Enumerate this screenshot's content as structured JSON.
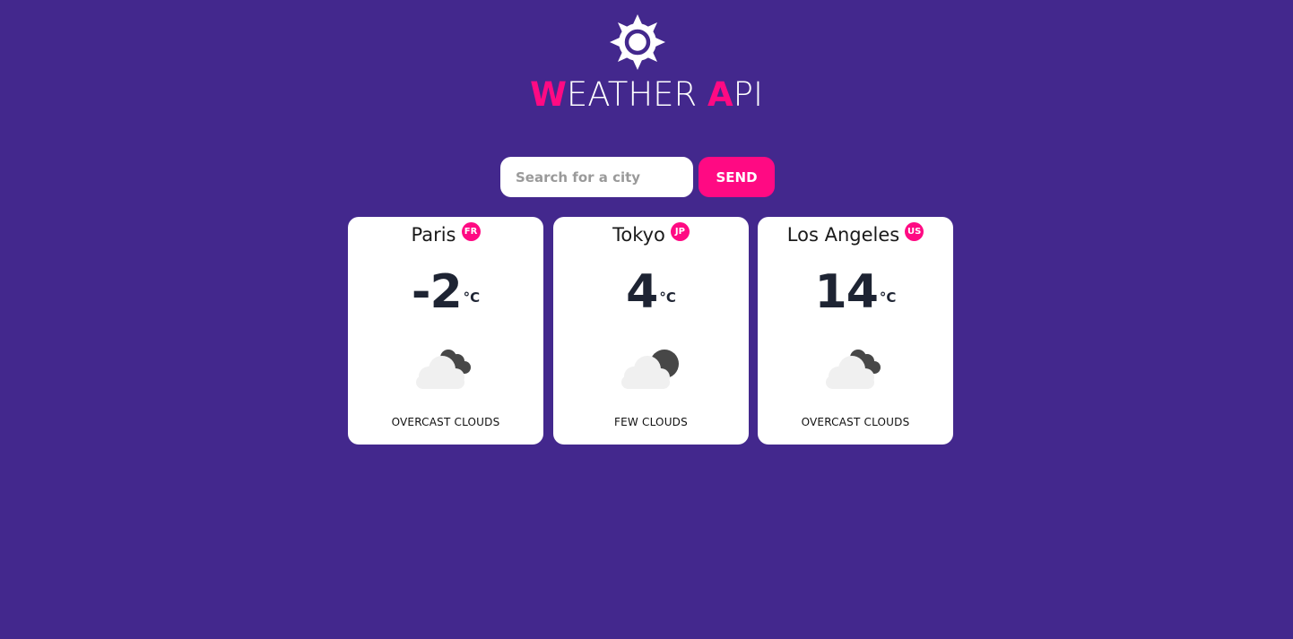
{
  "header": {
    "logo_icon": "sun-icon",
    "title_first_letter": "W",
    "title_first_rest": "EATHER ",
    "title_second_letter": "A",
    "title_second_rest": "PI"
  },
  "search": {
    "placeholder": "Search for a city",
    "value": "",
    "button_label": "SEND"
  },
  "colors": {
    "background": "#43288d",
    "accent": "#ff0a83",
    "card": "#ffffff",
    "text_dark": "#1e2433"
  },
  "cities": [
    {
      "name": "Paris",
      "country": "FR",
      "temperature": "-2",
      "unit": "°C",
      "icon": "overcast-clouds-icon",
      "condition": "OVERCAST CLOUDS"
    },
    {
      "name": "Tokyo",
      "country": "JP",
      "temperature": "4",
      "unit": "°C",
      "icon": "few-clouds-night-icon",
      "condition": "FEW CLOUDS"
    },
    {
      "name": "Los Angeles",
      "country": "US",
      "temperature": "14",
      "unit": "°C",
      "icon": "overcast-clouds-icon",
      "condition": "OVERCAST CLOUDS"
    }
  ]
}
